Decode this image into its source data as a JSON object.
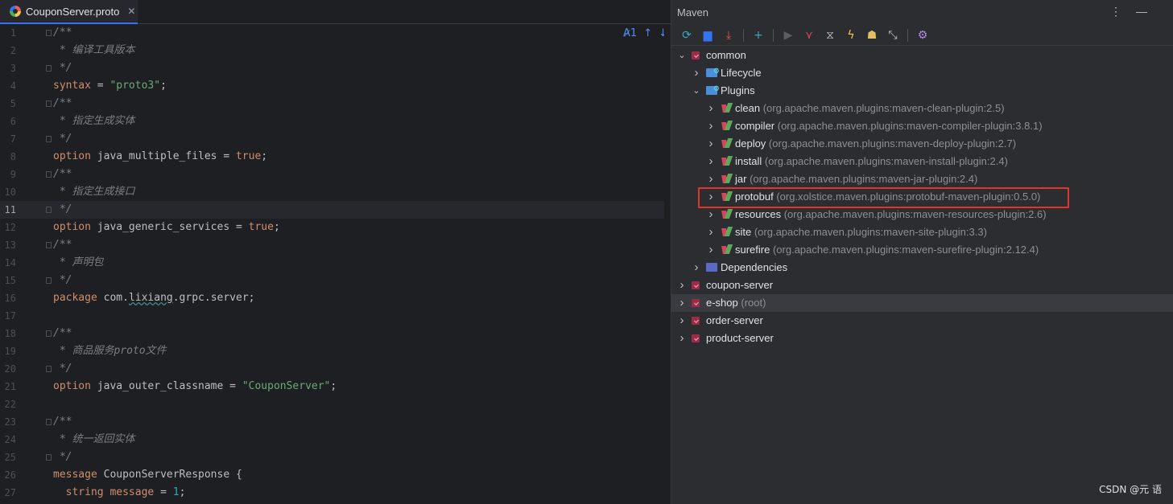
{
  "editor": {
    "tab": {
      "name": "CouponServer.proto",
      "close": "✕"
    },
    "tools": {
      "spell": "A̷1",
      "up": "↑",
      "down": "↓"
    },
    "current_line": 11,
    "lines": [
      {
        "n": "1",
        "t": "/**"
      },
      {
        "n": "2",
        "t": " * 编译工具版本"
      },
      {
        "n": "3",
        "t": " */"
      },
      {
        "n": "4",
        "t": "syntax = \"proto3\";"
      },
      {
        "n": "5",
        "t": "/**"
      },
      {
        "n": "6",
        "t": " * 指定生成实体"
      },
      {
        "n": "7",
        "t": " */"
      },
      {
        "n": "8",
        "t": "option java_multiple_files = true;"
      },
      {
        "n": "9",
        "t": "/**"
      },
      {
        "n": "10",
        "t": " * 指定生成接口"
      },
      {
        "n": "11",
        "t": " */"
      },
      {
        "n": "12",
        "t": "option java_generic_services = true;"
      },
      {
        "n": "13",
        "t": "/**"
      },
      {
        "n": "14",
        "t": " * 声明包"
      },
      {
        "n": "15",
        "t": " */"
      },
      {
        "n": "16",
        "t": "package com.lixiang.grpc.server;"
      },
      {
        "n": "17",
        "t": ""
      },
      {
        "n": "18",
        "t": "/**"
      },
      {
        "n": "19",
        "t": " * 商品服务proto文件"
      },
      {
        "n": "20",
        "t": " */"
      },
      {
        "n": "21",
        "t": "option java_outer_classname = \"CouponServer\";"
      },
      {
        "n": "22",
        "t": ""
      },
      {
        "n": "23",
        "t": "/**"
      },
      {
        "n": "24",
        "t": " * 统一返回实体"
      },
      {
        "n": "25",
        "t": " */"
      },
      {
        "n": "26",
        "t": "message CouponServerResponse {"
      },
      {
        "n": "27",
        "t": "  string message = 1;"
      }
    ]
  },
  "maven": {
    "title": "Maven",
    "menu_icons": [
      "more-vert-icon",
      "minimize-icon"
    ],
    "toolbar": [
      "reload-icon",
      "add-folder-icon",
      "download-icon",
      "plus-icon",
      "run-icon",
      "maven-goal-icon",
      "toggle-offline-icon",
      "skip-tests-icon",
      "show-dependencies-icon",
      "collapse-icon",
      "settings-icon"
    ],
    "tree": [
      {
        "id": "common",
        "level": 0,
        "kind": "module",
        "label": "common",
        "desc": "",
        "open": true
      },
      {
        "id": "lifecycle",
        "level": 1,
        "kind": "folder-gear",
        "label": "Lifecycle",
        "desc": "",
        "open": false
      },
      {
        "id": "plugins",
        "level": 1,
        "kind": "folder-gear",
        "label": "Plugins",
        "desc": "",
        "open": true
      },
      {
        "id": "clean",
        "level": 2,
        "kind": "plugin",
        "label": "clean",
        "desc": "(org.apache.maven.plugins:maven-clean-plugin:2.5)",
        "open": false
      },
      {
        "id": "compiler",
        "level": 2,
        "kind": "plugin",
        "label": "compiler",
        "desc": "(org.apache.maven.plugins:maven-compiler-plugin:3.8.1)",
        "open": false
      },
      {
        "id": "deploy",
        "level": 2,
        "kind": "plugin",
        "label": "deploy",
        "desc": "(org.apache.maven.plugins:maven-deploy-plugin:2.7)",
        "open": false
      },
      {
        "id": "install",
        "level": 2,
        "kind": "plugin",
        "label": "install",
        "desc": "(org.apache.maven.plugins:maven-install-plugin:2.4)",
        "open": false
      },
      {
        "id": "jar",
        "level": 2,
        "kind": "plugin",
        "label": "jar",
        "desc": "(org.apache.maven.plugins:maven-jar-plugin:2.4)",
        "open": false
      },
      {
        "id": "protobuf",
        "level": 2,
        "kind": "plugin",
        "label": "protobuf",
        "desc": "(org.xolstice.maven.plugins:protobuf-maven-plugin:0.5.0)",
        "open": false
      },
      {
        "id": "resources",
        "level": 2,
        "kind": "plugin",
        "label": "resources",
        "desc": "(org.apache.maven.plugins:maven-resources-plugin:2.6)",
        "open": false
      },
      {
        "id": "site",
        "level": 2,
        "kind": "plugin",
        "label": "site",
        "desc": "(org.apache.maven.plugins:maven-site-plugin:3.3)",
        "open": false
      },
      {
        "id": "surefire",
        "level": 2,
        "kind": "plugin",
        "label": "surefire",
        "desc": "(org.apache.maven.plugins:maven-surefire-plugin:2.12.4)",
        "open": false
      },
      {
        "id": "dependencies",
        "level": 1,
        "kind": "folder-dep",
        "label": "Dependencies",
        "desc": "",
        "open": false
      },
      {
        "id": "coupon-server",
        "level": 0,
        "kind": "module",
        "label": "coupon-server",
        "desc": "",
        "open": false
      },
      {
        "id": "e-shop",
        "level": 0,
        "kind": "module",
        "label": "e-shop",
        "desc": "(root)",
        "open": false,
        "selected": true
      },
      {
        "id": "order-server",
        "level": 0,
        "kind": "module",
        "label": "order-server",
        "desc": "",
        "open": false
      },
      {
        "id": "product-server",
        "level": 0,
        "kind": "module",
        "label": "product-server",
        "desc": "",
        "open": false
      }
    ],
    "highlight_row": "protobuf"
  },
  "watermark": "CSDN @元 语",
  "colors": {
    "highlight_box": "#e0352b",
    "accent": "#3574f0"
  }
}
